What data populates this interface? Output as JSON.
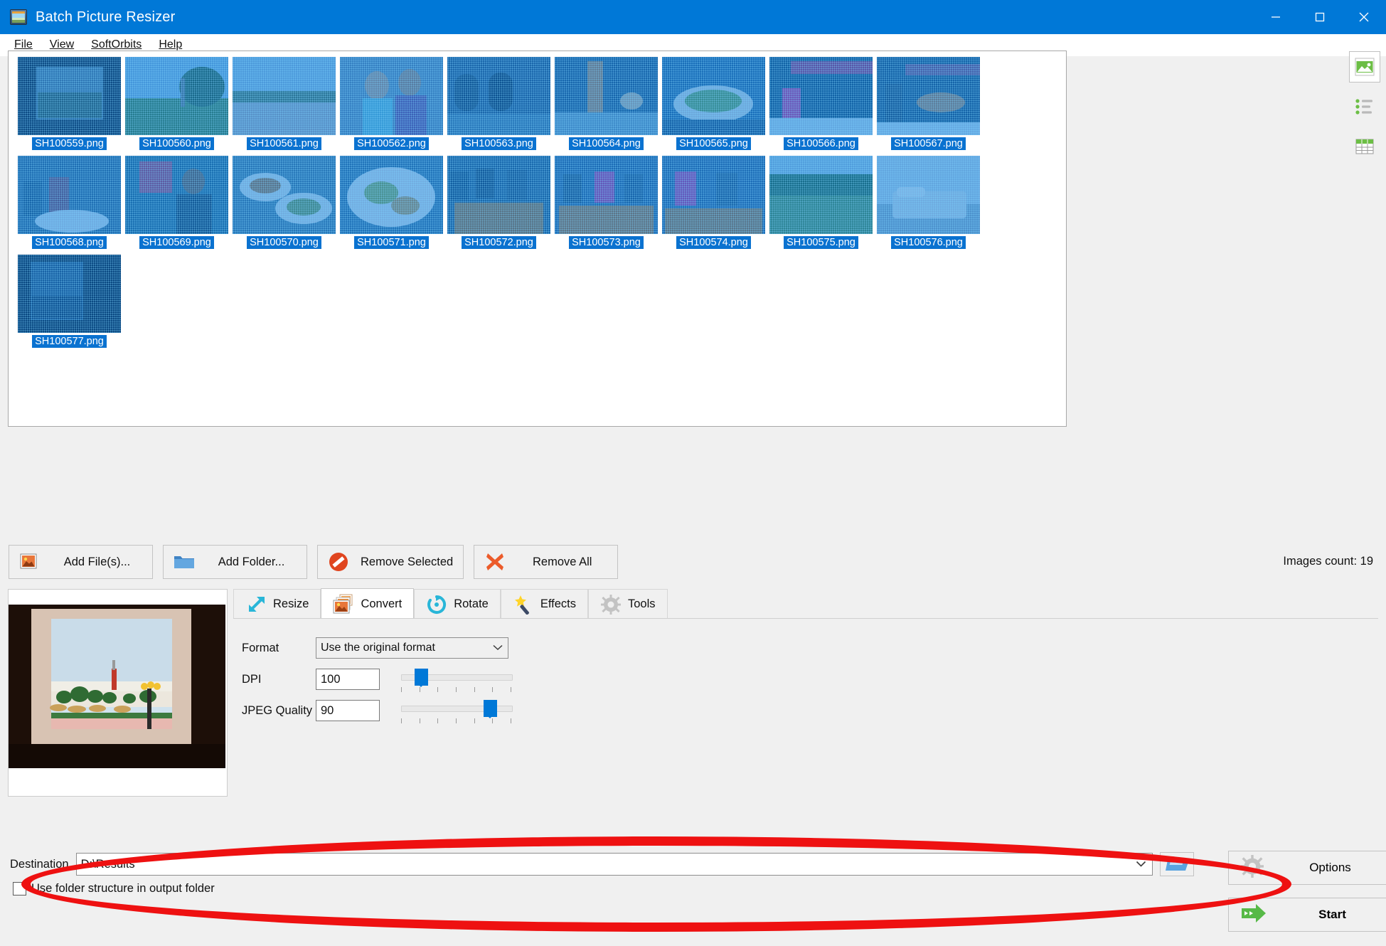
{
  "window": {
    "title": "Batch Picture Resizer",
    "icon": "app-icon",
    "minimize": "—",
    "maximize": "□",
    "close": "✕"
  },
  "menubar": {
    "items": [
      {
        "label": "File",
        "accel": "F"
      },
      {
        "label": "View",
        "accel": "V"
      },
      {
        "label": "SoftOrbits",
        "accel": "O"
      },
      {
        "label": "Help",
        "accel": "H"
      }
    ]
  },
  "file_list": {
    "selected_all": true,
    "files": [
      {
        "name": "SH100559.png",
        "scene": "window-frame-view"
      },
      {
        "name": "SH100560.png",
        "scene": "park-trees-lawn"
      },
      {
        "name": "SH100561.png",
        "scene": "promenade-path"
      },
      {
        "name": "SH100562.png",
        "scene": "two-people-portrait"
      },
      {
        "name": "SH100563.png",
        "scene": "hotel-lobby-arches"
      },
      {
        "name": "SH100564.png",
        "scene": "buffet-hall-pillar"
      },
      {
        "name": "SH100565.png",
        "scene": "buffet-table-food"
      },
      {
        "name": "SH100566.png",
        "scene": "restaurant-counter"
      },
      {
        "name": "SH100567.png",
        "scene": "poolside-bar"
      },
      {
        "name": "SH100568.png",
        "scene": "people-at-table"
      },
      {
        "name": "SH100569.png",
        "scene": "man-with-plate"
      },
      {
        "name": "SH100570.png",
        "scene": "plates-of-food"
      },
      {
        "name": "SH100571.png",
        "scene": "dinner-plate-closeup"
      },
      {
        "name": "SH100572.png",
        "scene": "group-dining"
      },
      {
        "name": "SH100573.png",
        "scene": "family-dining"
      },
      {
        "name": "SH100574.png",
        "scene": "two-women-table"
      },
      {
        "name": "SH100575.png",
        "scene": "garden-lawn"
      },
      {
        "name": "SH100576.png",
        "scene": "hotel-bedroom"
      },
      {
        "name": "SH100577.png",
        "scene": "dark-window-view"
      }
    ]
  },
  "view_modes": {
    "items": [
      {
        "name": "thumbnails-view",
        "icon": "image-icon",
        "active": true
      },
      {
        "name": "list-view",
        "icon": "list-icon",
        "active": false
      },
      {
        "name": "details-view",
        "icon": "table-icon",
        "active": false
      }
    ]
  },
  "actions": {
    "buttons": [
      {
        "label": "Add File(s)...",
        "accel": "i",
        "icon": "picture-add-icon"
      },
      {
        "label": "Add Folder...",
        "accel": "o",
        "icon": "folder-icon"
      },
      {
        "label": "Remove Selected",
        "accel": "S",
        "icon": "no-entry-icon"
      },
      {
        "label": "Remove All",
        "accel": "A",
        "icon": "red-cross-icon"
      }
    ],
    "images_count_label": "Images count: 19"
  },
  "tabs": [
    {
      "label": "Resize",
      "icon": "resize-arrows-icon",
      "active": false
    },
    {
      "label": "Convert",
      "icon": "convert-images-icon",
      "active": true
    },
    {
      "label": "Rotate",
      "icon": "rotate-circle-icon",
      "active": false
    },
    {
      "label": "Effects",
      "icon": "magic-wand-icon",
      "active": false
    },
    {
      "label": "Tools",
      "icon": "gear-icon",
      "active": false
    }
  ],
  "convert_panel": {
    "format_label": "Format",
    "format_value": "Use the original format",
    "dpi_label": "DPI",
    "dpi_value": "100",
    "dpi_slider_percent": 14,
    "jpeg_label": "JPEG Quality",
    "jpeg_value": "90",
    "jpeg_slider_percent": 85
  },
  "destination": {
    "label": "Destination",
    "value": "D:\\Results",
    "browse_icon": "open-folder-icon",
    "checkbox_label": "Use folder structure in output folder",
    "checkbox_checked": false
  },
  "footer_buttons": {
    "options_label": "Options",
    "options_icon": "gear-icon",
    "start_label": "Start",
    "start_icon": "green-arrow-icon"
  },
  "annotation": {
    "shape": "red-ellipse-highlight",
    "color": "#ee1111"
  },
  "colors": {
    "titlebar": "#0078d7",
    "accent": "#0078d7",
    "selection": "#0a72d0",
    "panel": "#f0f0f0",
    "annotation": "#ee1111"
  }
}
